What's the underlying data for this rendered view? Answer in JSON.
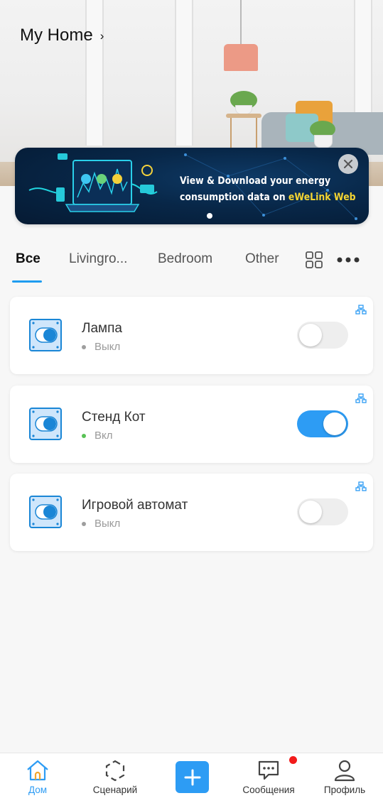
{
  "header": {
    "home_name": "My Home",
    "chevron": "›"
  },
  "banner": {
    "line1": "View & Download your energy",
    "line2_prefix": "consumption data on ",
    "line2_highlight": "eWeLink Web",
    "close_icon": "close-icon",
    "page_count": 1,
    "active_page": 1,
    "highlight_color": "#f5d532"
  },
  "tabs": {
    "items": [
      "Все",
      "Livingro...",
      "Bedroom",
      "Other"
    ],
    "active_index": 0,
    "grid_icon": "grid-icon",
    "more_icon": "more-icon"
  },
  "devices": [
    {
      "name": "Лампа",
      "status": "Выкл",
      "on": false,
      "icon": "switch-device-icon"
    },
    {
      "name": "Стенд Кот",
      "status": "Вкл",
      "on": true,
      "icon": "switch-device-icon"
    },
    {
      "name": "Игровой автомат",
      "status": "Выкл",
      "on": false,
      "icon": "switch-device-icon"
    }
  ],
  "bottom_nav": {
    "home": "Дом",
    "scenes": "Сценарий",
    "messages": "Сообщения",
    "profile": "Профиль",
    "active": "home",
    "messages_has_badge": true
  },
  "colors": {
    "accent": "#2d9cf4",
    "toggle_off": "#eeeeee",
    "status_on": "#58c255",
    "status_off": "#9e9e9e",
    "badge": "#f21b1b"
  }
}
